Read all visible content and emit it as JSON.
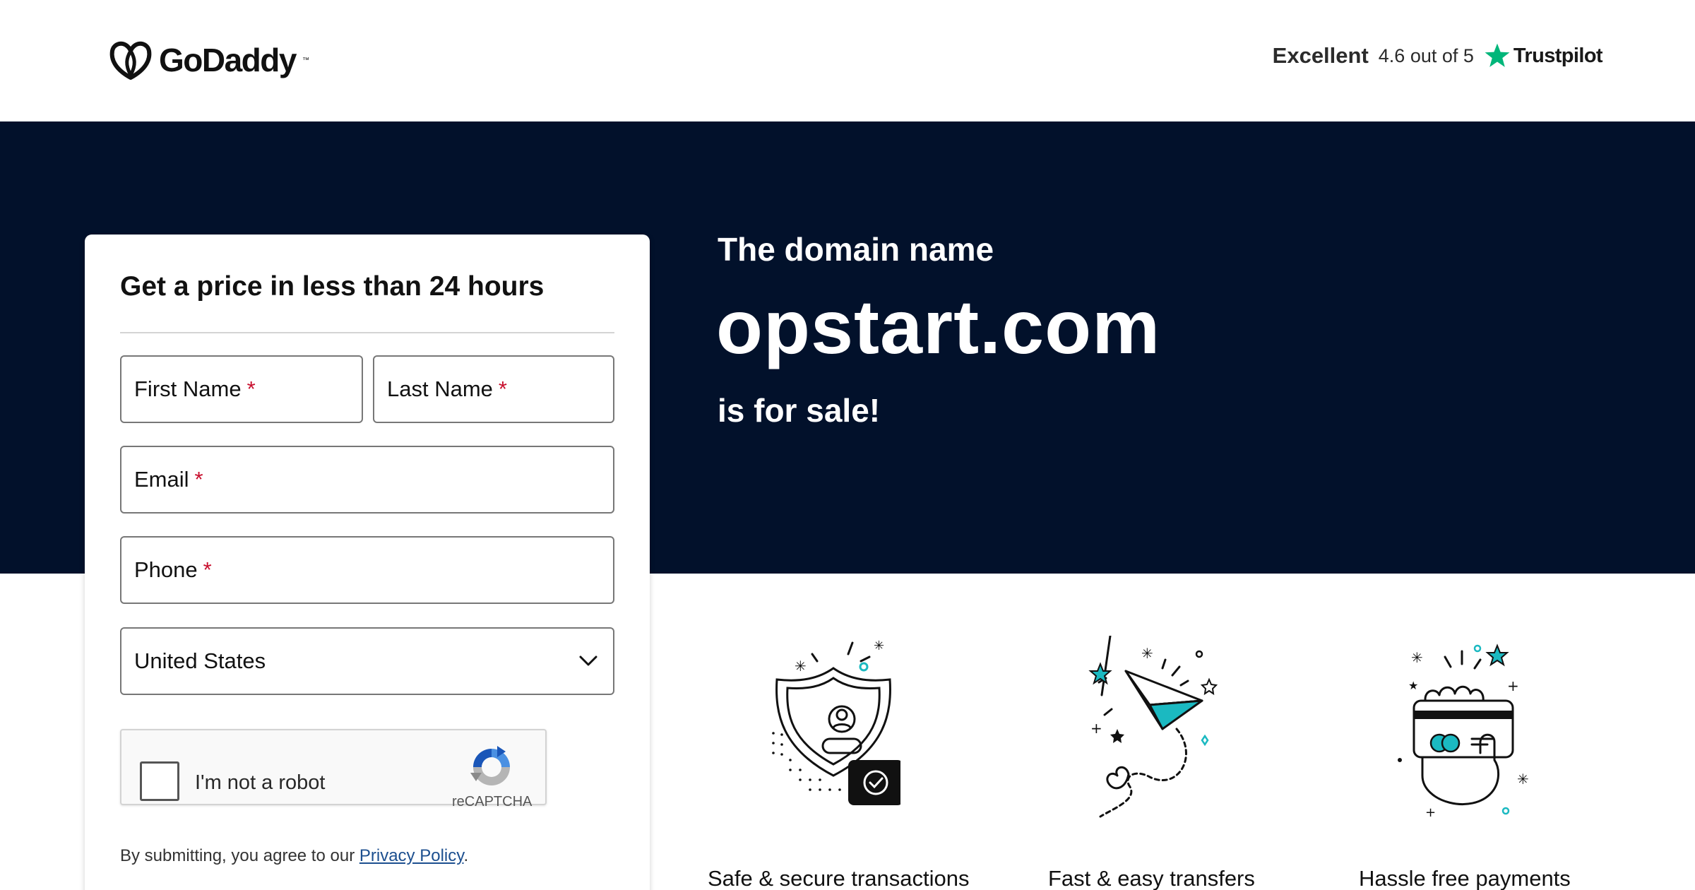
{
  "header": {
    "logo_text": "GoDaddy",
    "logo_tm": "™",
    "rating_word": "Excellent",
    "rating_score": "4.6 out of 5",
    "trustpilot_label": "Trustpilot"
  },
  "hero": {
    "line1": "The domain name",
    "domain": "opstart.com",
    "line2": "is for sale!"
  },
  "form": {
    "title": "Get a price in less than 24 hours",
    "first_name": "First Name",
    "last_name": "Last Name",
    "email": "Email",
    "phone": "Phone",
    "required_mark": "*",
    "country": "United States",
    "captcha_label": "I'm not a robot",
    "captcha_brand": "reCAPTCHA",
    "consent_prefix": "By submitting, you agree to our",
    "consent_link": "Privacy Policy",
    "consent_suffix": "."
  },
  "features": [
    {
      "label": "Safe & secure transactions",
      "icon": "shield-icon"
    },
    {
      "label": "Fast & easy transfers",
      "icon": "paper-plane-icon"
    },
    {
      "label": "Hassle free payments",
      "icon": "credit-card-hand-icon"
    }
  ],
  "colors": {
    "hero_bg": "#02112b",
    "accent_teal": "#1bb9c1",
    "trustpilot_green": "#00b67a",
    "required_red": "#c8102e",
    "link_blue": "#1c4f8f"
  }
}
